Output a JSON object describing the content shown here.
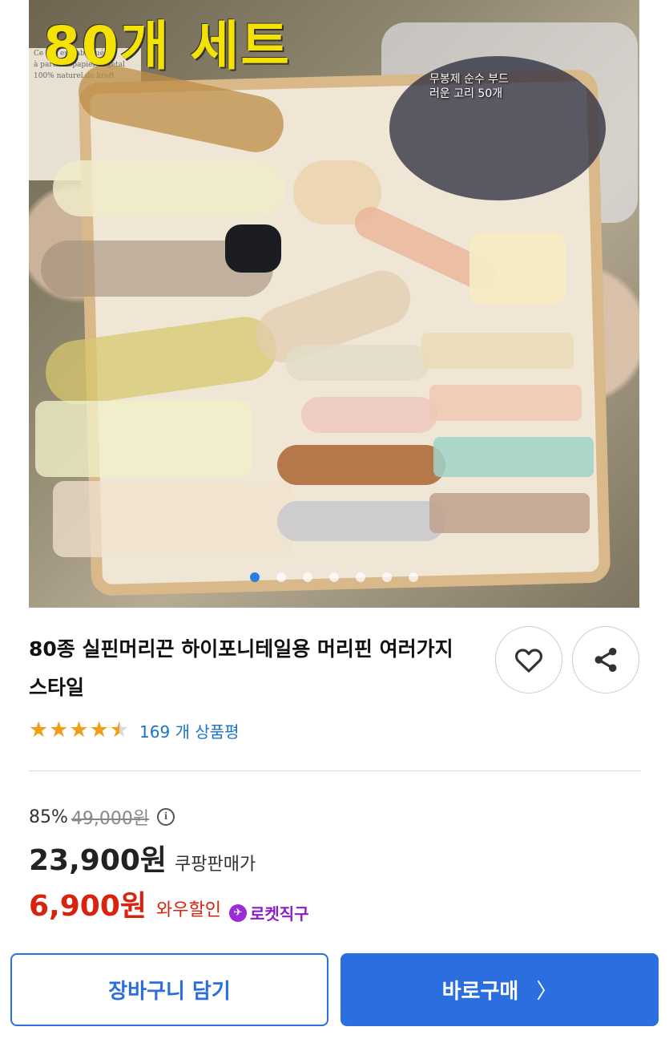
{
  "image": {
    "overlay_title": "80개 세트",
    "overlay_note": "무봉제 순수 부드러운 고리 50개",
    "card_lines": [
      "Ce sac est fabriqué",
      "à partir depapier vegetal",
      "100% naturel.de kraft"
    ],
    "carousel": {
      "total": 7,
      "active_index": 0
    }
  },
  "product": {
    "title": "80종 실핀머리끈 하이포니테일용 머리핀 여러가지 스타일",
    "rating": {
      "stars": 4.5,
      "review_count": "169 개 상품평"
    }
  },
  "actions": {
    "like_icon": "heart-icon",
    "share_icon": "share-icon"
  },
  "price": {
    "discount": "85%",
    "original": "49,000원",
    "coupang": "23,900원",
    "coupang_label": "쿠팡판매가",
    "wow": "6,900원",
    "wow_label": "와우할인",
    "rocket_label": "로켓직구"
  },
  "buttons": {
    "cart": "장바구니 담기",
    "buy": "바로구매"
  },
  "colors": {
    "accent_blue": "#2a6ee0",
    "sale_red": "#d8230f",
    "star_orange": "#f39c16",
    "rocket_purple": "#8a1fc8"
  }
}
